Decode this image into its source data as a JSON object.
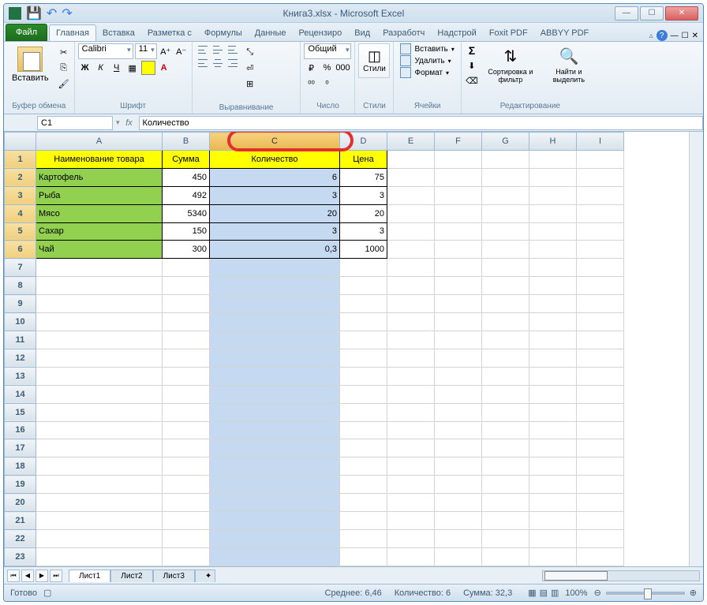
{
  "window": {
    "title": "Книга3.xlsx  -  Microsoft Excel"
  },
  "tabs": {
    "file": "Файл",
    "items": [
      "Главная",
      "Вставка",
      "Разметка с",
      "Формулы",
      "Данные",
      "Рецензиро",
      "Вид",
      "Разработч",
      "Надстрой",
      "Foxit PDF",
      "ABBYY PDF"
    ]
  },
  "ribbon": {
    "paste": "Вставить",
    "clipboard": "Буфер обмена",
    "font_name": "Calibri",
    "font_size": "11",
    "font_label": "Шрифт",
    "align_label": "Выравнивание",
    "number_format": "Общий",
    "number_label": "Число",
    "styles": "Стили",
    "cells_insert": "Вставить",
    "cells_delete": "Удалить",
    "cells_format": "Формат",
    "cells_label": "Ячейки",
    "sort": "Сортировка и фильтр",
    "find": "Найти и выделить",
    "edit_label": "Редактирование"
  },
  "formula_bar": {
    "name_box": "C1",
    "formula": "Количество"
  },
  "columns": [
    "A",
    "B",
    "C",
    "D",
    "E",
    "F",
    "G",
    "H",
    "I"
  ],
  "headers": {
    "A": "Наименование товара",
    "B": "Сумма",
    "C": "Количество",
    "D": "Цена"
  },
  "rows": [
    {
      "A": "Картофель",
      "B": "450",
      "C": "6",
      "D": "75"
    },
    {
      "A": "Рыба",
      "B": "492",
      "C": "3",
      "D": "3"
    },
    {
      "A": "Мясо",
      "B": "5340",
      "C": "20",
      "D": "20"
    },
    {
      "A": "Сахар",
      "B": "150",
      "C": "3",
      "D": "3"
    },
    {
      "A": "Чай",
      "B": "300",
      "C": "0,3",
      "D": "1000"
    }
  ],
  "sheets": [
    "Лист1",
    "Лист2",
    "Лист3"
  ],
  "status": {
    "ready": "Готово",
    "avg_label": "Среднее:",
    "avg": "6,46",
    "count_label": "Количество:",
    "count": "6",
    "sum_label": "Сумма:",
    "sum": "32,3",
    "zoom": "100%"
  },
  "chart_data": {
    "type": "table",
    "title": "",
    "columns": [
      "Наименование товара",
      "Сумма",
      "Количество",
      "Цена"
    ],
    "rows": [
      [
        "Картофель",
        450,
        6,
        75
      ],
      [
        "Рыба",
        492,
        3,
        3
      ],
      [
        "Мясо",
        5340,
        20,
        20
      ],
      [
        "Сахар",
        150,
        3,
        3
      ],
      [
        "Чай",
        300,
        0.3,
        1000
      ]
    ]
  }
}
